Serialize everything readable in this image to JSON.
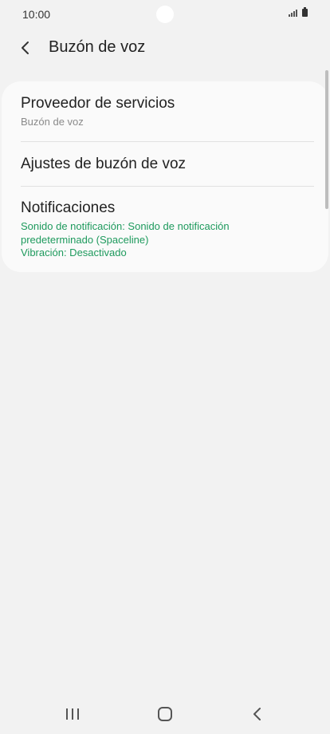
{
  "status_bar": {
    "time": "10:00"
  },
  "app_bar": {
    "title": "Buzón de voz"
  },
  "settings": {
    "items": [
      {
        "title": "Proveedor de servicios",
        "subtitle": "Buzón de voz"
      },
      {
        "title": "Ajustes de buzón de voz"
      },
      {
        "title": "Notificaciones",
        "details": [
          "Sonido de notificación: Sonido de notificación",
          "predeterminado (Spaceline)",
          "Vibración: Desactivado"
        ]
      }
    ]
  },
  "colors": {
    "background": "#f2f2f2",
    "card": "#fafafa",
    "accent_green": "#1e9a5d",
    "subtitle_gray": "#8a8a8a"
  },
  "icons": {
    "back": "chevron-left-icon",
    "nav_recents": "recents-icon",
    "nav_home": "home-icon",
    "nav_back": "back-icon"
  }
}
